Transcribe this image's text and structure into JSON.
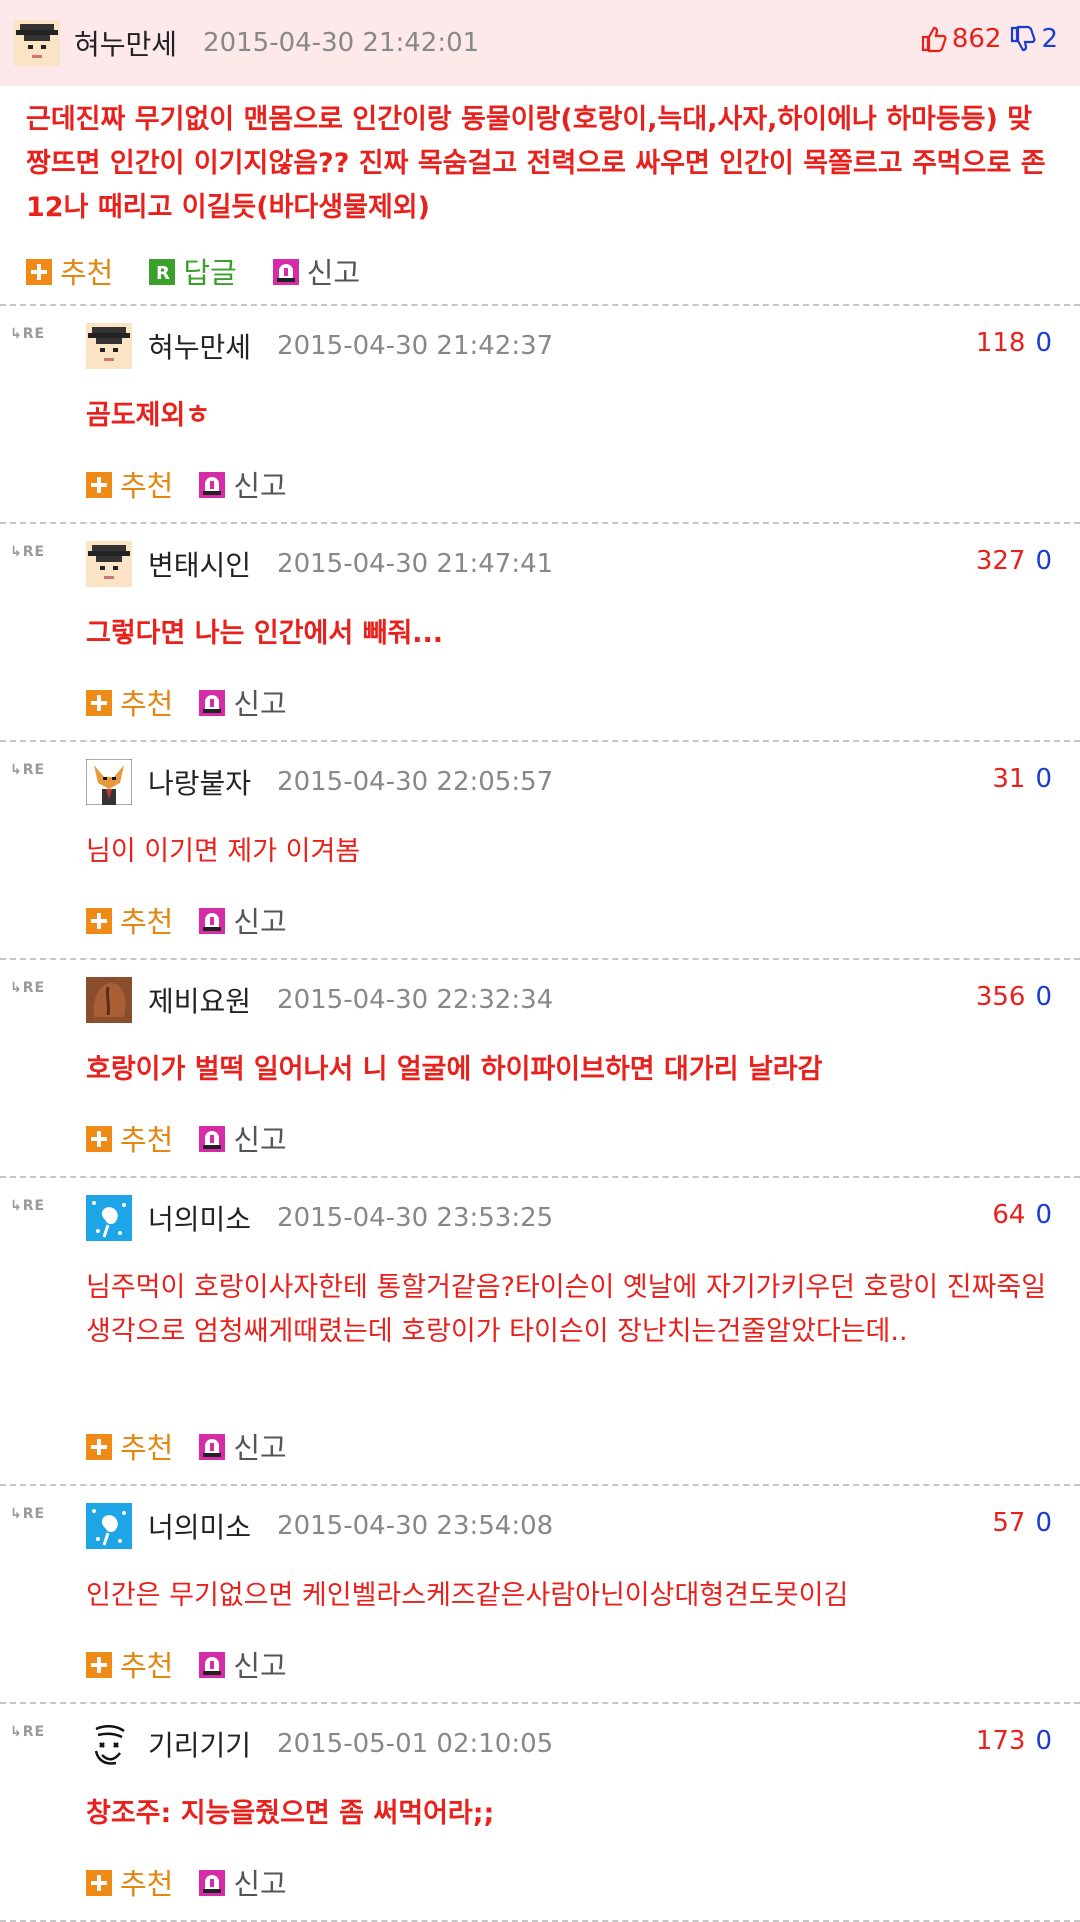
{
  "post": {
    "author": "혀누만세",
    "date": "2015-04-30 21:42:01",
    "up": "862",
    "down": "2",
    "body": "근데진짜 무기없이 맨몸으로 인간이랑 동물이랑(호랑이,늑대,사자,하이에나 하마등등) 맞짱뜨면 인간이 이기지않음?? 진짜 목숨걸고 전력으로 싸우면 인간이 목쫄르고 주먹으로 존12나 때리고 이길듯(바다생물제외)",
    "actions": {
      "recommend": "추천",
      "reply": "답글",
      "report": "신고"
    }
  },
  "reply_prefix": "RE",
  "replies": [
    {
      "author": "혀누만세",
      "date": "2015-04-30 21:42:37",
      "up": "118",
      "down": "0",
      "body": "곰도제외ㅎ",
      "avatar": "grad-cap-icon"
    },
    {
      "author": "변태시인",
      "date": "2015-04-30 21:47:41",
      "up": "327",
      "down": "0",
      "body": "그렇다면 나는 인간에서 빼줘...",
      "avatar": "grad-cap-icon"
    },
    {
      "author": "나랑붙자",
      "date": "2015-04-30 22:05:57",
      "up": "31",
      "down": "0",
      "body": "님이 이기면 제가 이겨봄",
      "avatar": "fox-suit-icon"
    },
    {
      "author": "제비요원",
      "date": "2015-04-30 22:32:34",
      "up": "356",
      "down": "0",
      "body": "호랑이가 벌떡 일어나서 니 얼굴에 하이파이브하면 대가리 날라감",
      "avatar": "brown-blob-icon"
    },
    {
      "author": "너의미소",
      "date": "2015-04-30 23:53:25",
      "up": "64",
      "down": "0",
      "body": "님주먹이 호랑이사자한테 통할거같음?타이슨이 옛날에 자기가키우던 호랑이 진짜죽일생각으로 엄청쌔게때렸는데 호랑이가 타이슨이 장난치는건줄알았다는데..",
      "avatar": "blue-splash-icon"
    },
    {
      "author": "너의미소",
      "date": "2015-04-30 23:54:08",
      "up": "57",
      "down": "0",
      "body": "인간은 무기없으면 케인벨라스케즈같은사람아닌이상대형견도못이김",
      "avatar": "blue-splash-icon"
    },
    {
      "author": "기리기기",
      "date": "2015-05-01 02:10:05",
      "up": "173",
      "down": "0",
      "body": "창조주: 지능을줬으면 좀 써먹어라;;",
      "avatar": "scribble-face-icon"
    }
  ],
  "colors": {
    "accent_red": "#e8211c",
    "down_blue": "#1a3cd0",
    "header_bg": "#fde8ea",
    "recommend_orange": "#e48710",
    "reply_green": "#3aa02b"
  }
}
